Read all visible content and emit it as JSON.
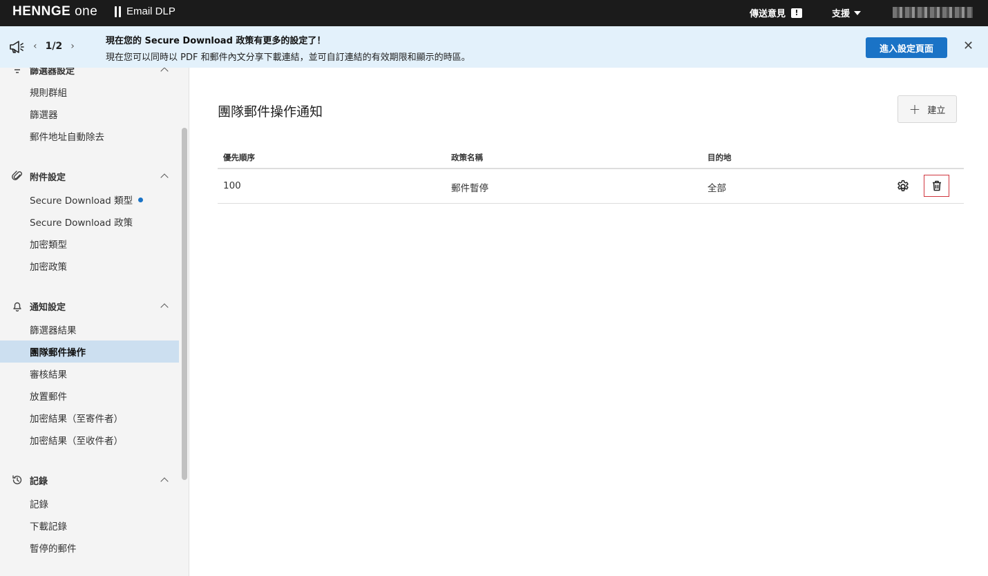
{
  "topbar": {
    "logo_main": "HENNGE",
    "logo_sub": "one",
    "product": "Email DLP",
    "feedback_label": "傳送意見",
    "support_label": "支援"
  },
  "banner": {
    "pager": "1/2",
    "title": "現在您的 Secure Download 政策有更多的設定了！",
    "description": "現在您可以同時以 PDF 和郵件內文分享下載連結，並可自訂連結的有效期限和顯示的時區。",
    "button_label": "進入設定頁面"
  },
  "sidebar": {
    "filter_section": {
      "label": "篩選器設定",
      "items": [
        "規則群組",
        "篩選器",
        "郵件地址自動除去"
      ]
    },
    "attachment_section": {
      "label": "附件設定",
      "items": [
        "Secure Download 類型",
        "Secure Download 政策",
        "加密類型",
        "加密政策"
      ]
    },
    "notify_section": {
      "label": "通知設定",
      "items": [
        "篩選器結果",
        "團隊郵件操作",
        "審核結果",
        "放置郵件",
        "加密結果（至寄件者）",
        "加密結果（至收件者）"
      ]
    },
    "log_section": {
      "label": "記錄",
      "items": [
        "記錄",
        "下載記錄",
        "暫停的郵件"
      ]
    }
  },
  "main": {
    "title": "團隊郵件操作通知",
    "create_label": "建立",
    "table": {
      "headers": [
        "優先順序",
        "政策名稱",
        "目的地"
      ],
      "rows": [
        {
          "priority": "100",
          "policy": "郵件暫停",
          "destination": "全部"
        }
      ]
    }
  },
  "colors": {
    "topbar_bg": "#1b1b1b",
    "banner_bg": "#e3f1fb",
    "primary": "#1a73c6",
    "active_item_bg": "#ccdff0",
    "delete_outline": "#d0353d"
  }
}
